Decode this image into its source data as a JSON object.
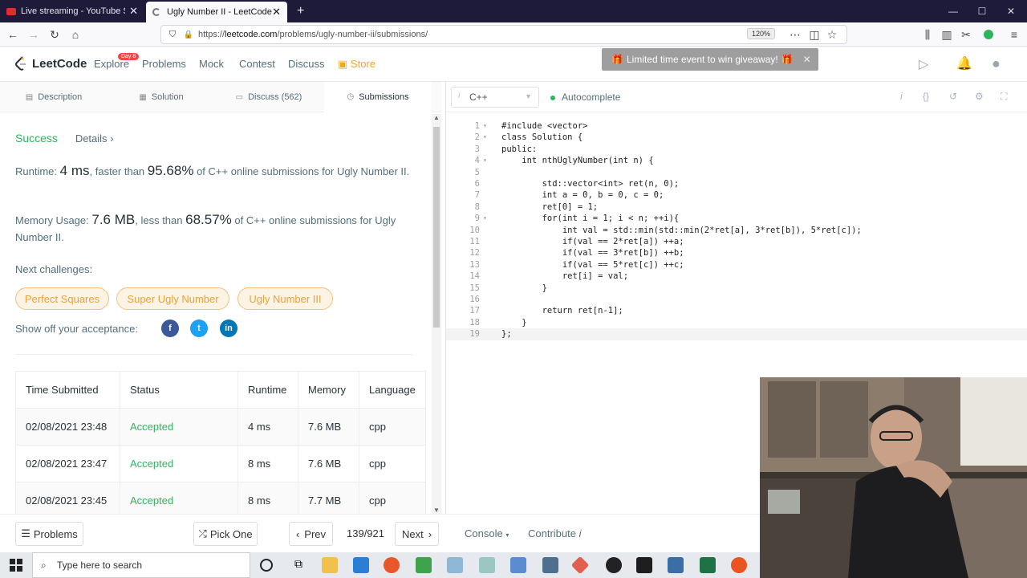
{
  "browser": {
    "tabs": [
      {
        "title": "Live streaming - YouTube Studio"
      },
      {
        "title": "Ugly Number II - LeetCode"
      }
    ],
    "new_tab": "+",
    "url_prefix": "https://",
    "url_host": "leetcode.com",
    "url_path": "/problems/ugly-number-ii/submissions/",
    "zoom": "120%"
  },
  "leetcode": {
    "logo": "LeetCode",
    "nav": [
      "Explore",
      "Problems",
      "Mock",
      "Contest",
      "Discuss",
      "Store"
    ],
    "day_badge": "Day 8",
    "toast": "Limited time event to win giveaway!"
  },
  "left": {
    "tabs": [
      "Description",
      "Solution",
      "Discuss (562)",
      "Submissions"
    ],
    "status": "Success",
    "details": "Details",
    "runtime_label": "Runtime:",
    "runtime_value": "4 ms",
    "runtime_mid": ", faster than",
    "runtime_pct": "95.68%",
    "runtime_tail": "of C++ online submissions for Ugly Number II.",
    "memory_label": "Memory Usage:",
    "memory_value": "7.6 MB",
    "memory_mid": ", less than",
    "memory_pct": "68.57%",
    "memory_tail": "of C++ online submissions for Ugly Number II.",
    "next_challenges": "Next challenges:",
    "challenges": [
      "Perfect Squares",
      "Super Ugly Number",
      "Ugly Number III"
    ],
    "show_off": "Show off your acceptance:",
    "table_headers": [
      "Time Submitted",
      "Status",
      "Runtime",
      "Memory",
      "Language"
    ],
    "rows": [
      {
        "time": "02/08/2021 23:48",
        "status": "Accepted",
        "runtime": "4 ms",
        "memory": "7.6 MB",
        "lang": "cpp"
      },
      {
        "time": "02/08/2021 23:47",
        "status": "Accepted",
        "runtime": "8 ms",
        "memory": "7.6 MB",
        "lang": "cpp"
      },
      {
        "time": "02/08/2021 23:45",
        "status": "Accepted",
        "runtime": "8 ms",
        "memory": "7.7 MB",
        "lang": "cpp"
      }
    ]
  },
  "editor": {
    "language": "C++",
    "autocomplete": "Autocomplete",
    "lines": [
      "#include <vector>",
      "class Solution {",
      "public:",
      "    int nthUglyNumber(int n) {",
      "",
      "        std::vector<int> ret(n, 0);",
      "        int a = 0, b = 0, c = 0;",
      "        ret[0] = 1;",
      "        for(int i = 1; i < n; ++i){",
      "            int val = std::min(std::min(2*ret[a], 3*ret[b]), 5*ret[c]);",
      "            if(val == 2*ret[a]) ++a;",
      "            if(val == 3*ret[b]) ++b;",
      "            if(val == 5*ret[c]) ++c;",
      "            ret[i] = val;",
      "        }",
      "",
      "        return ret[n-1];",
      "    }",
      "};"
    ]
  },
  "bottom": {
    "problems": "Problems",
    "pick_one": "Pick One",
    "prev": "Prev",
    "page": "139/921",
    "next": "Next",
    "console": "Console",
    "contribute": "Contribute"
  },
  "taskbar": {
    "search_placeholder": "Type here to search"
  },
  "colors": {
    "accent_green": "#2db55d",
    "store_orange": "#f5a623",
    "challenge_orange": "#e6a33c",
    "browser_tabbar": "#1d1a3a"
  }
}
